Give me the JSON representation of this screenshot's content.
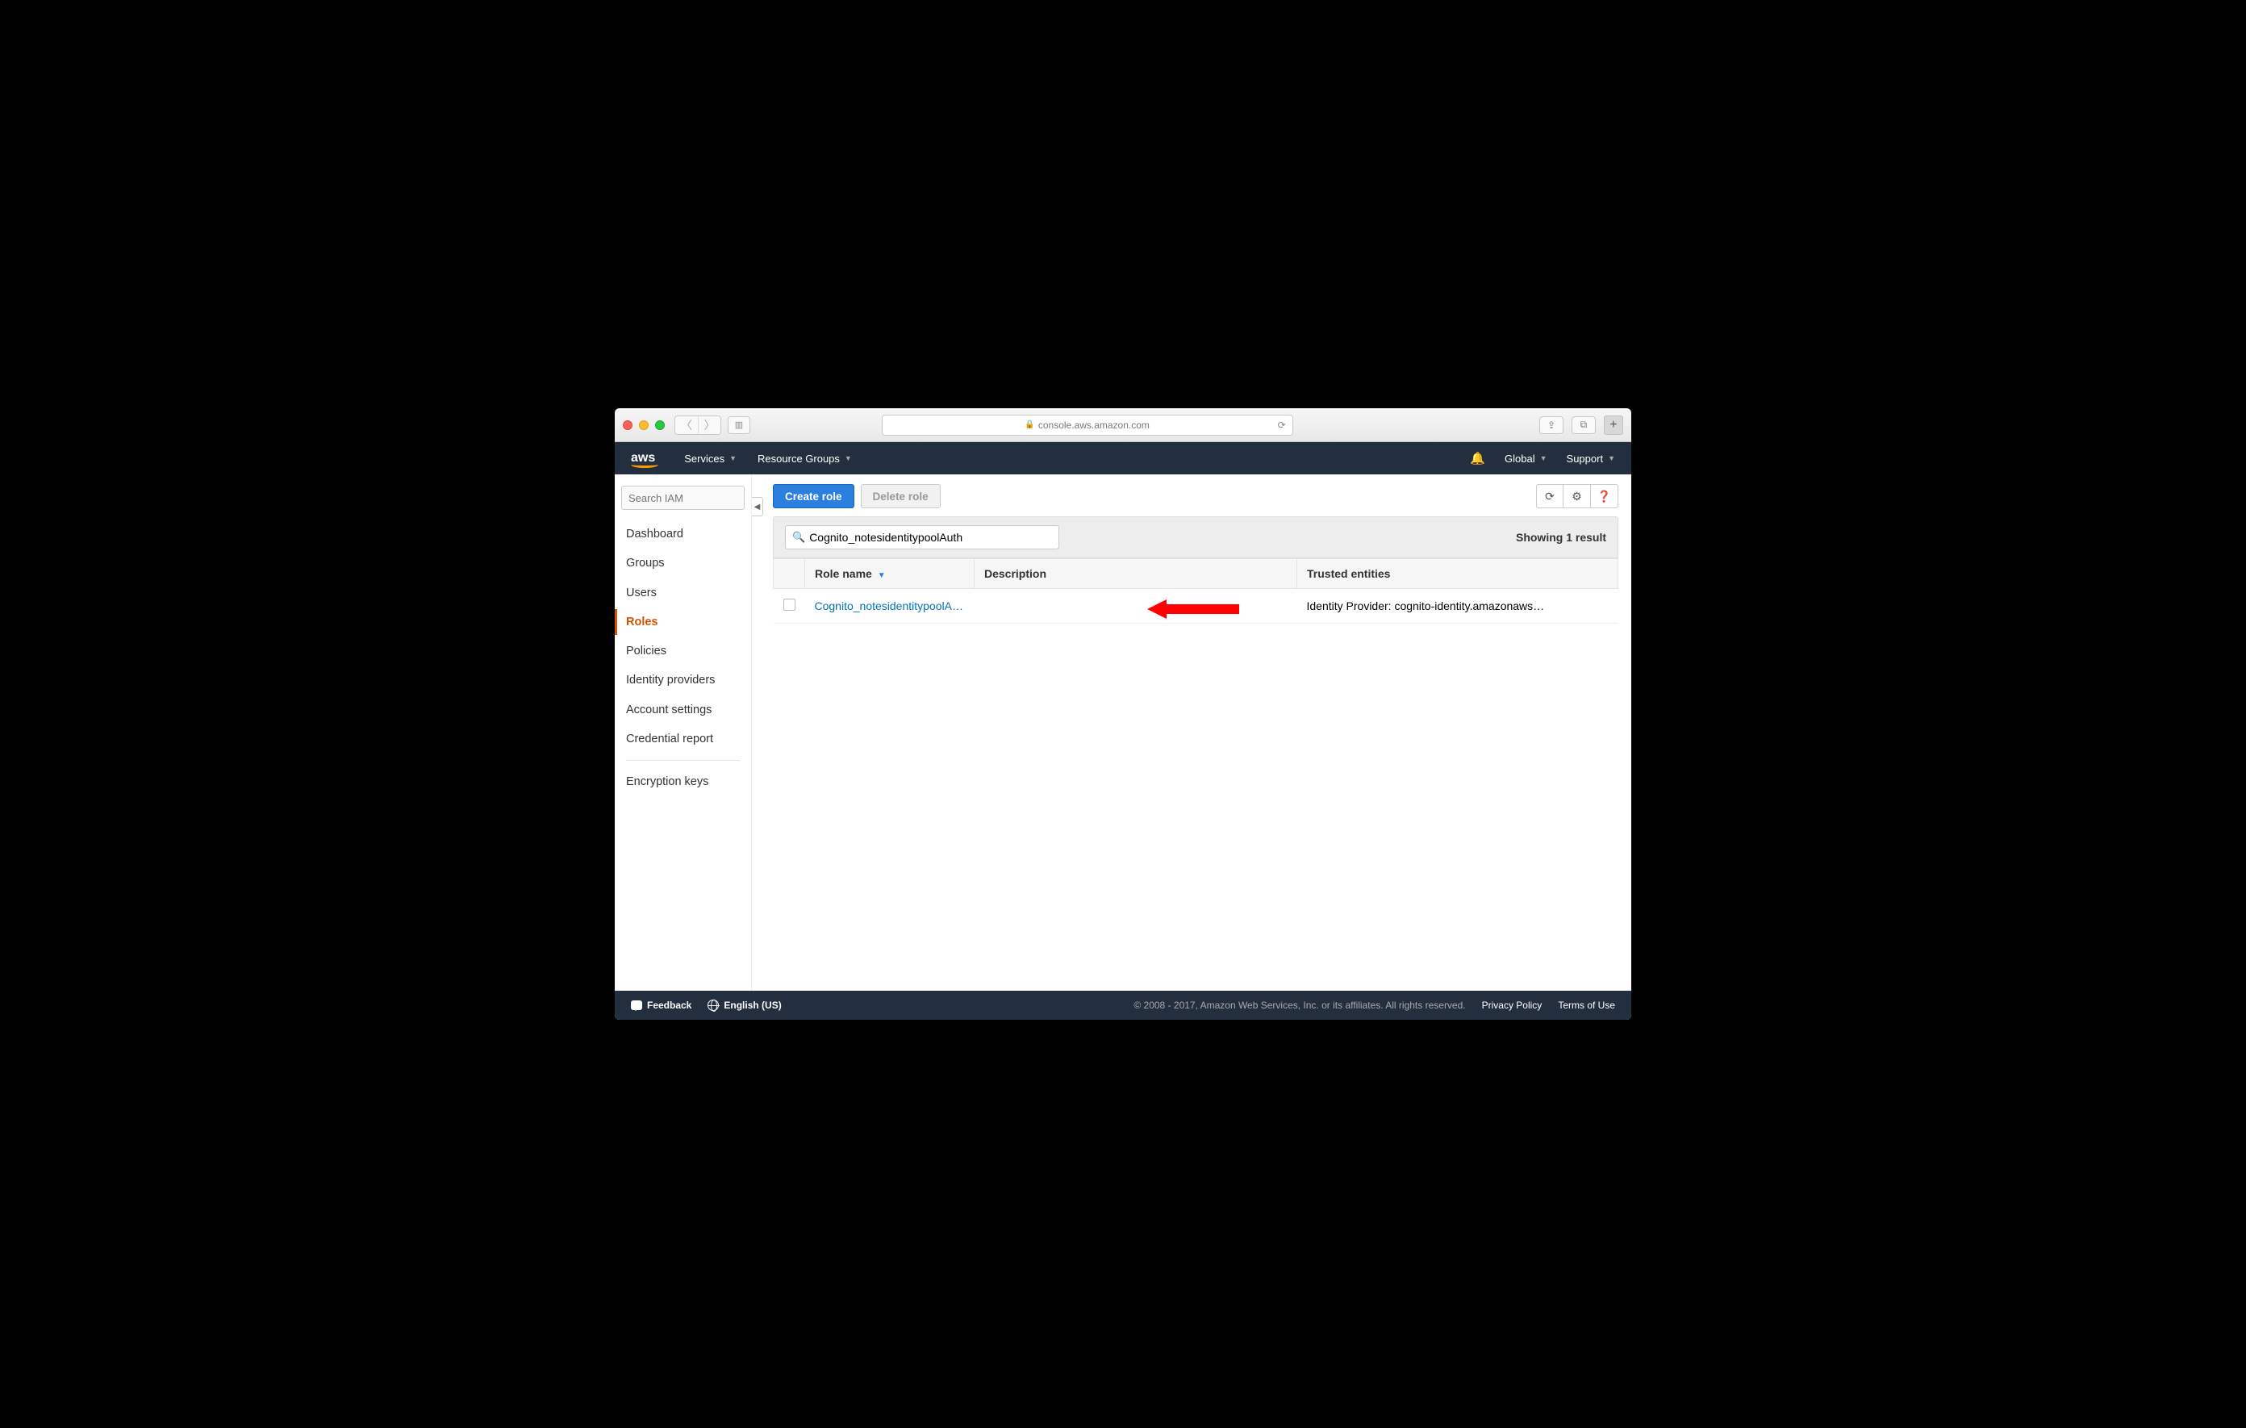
{
  "browser": {
    "url": "console.aws.amazon.com"
  },
  "header": {
    "logo": "aws",
    "services": "Services",
    "resource_groups": "Resource Groups",
    "region": "Global",
    "support": "Support"
  },
  "sidebar": {
    "search_placeholder": "Search IAM",
    "items": [
      "Dashboard",
      "Groups",
      "Users",
      "Roles",
      "Policies",
      "Identity providers",
      "Account settings",
      "Credential report"
    ],
    "active_index": 3,
    "bottom_item": "Encryption keys"
  },
  "toolbar": {
    "create_role": "Create role",
    "delete_role": "Delete role"
  },
  "filter": {
    "search_value": "Cognito_notesidentitypoolAuth",
    "result_text": "Showing 1 result"
  },
  "table": {
    "columns": {
      "role_name": "Role name",
      "description": "Description",
      "trusted": "Trusted entities"
    },
    "rows": [
      {
        "role_name": "Cognito_notesidentitypoolA…",
        "description": "",
        "trusted": "Identity Provider: cognito-identity.amazonaws…"
      }
    ]
  },
  "footer": {
    "feedback": "Feedback",
    "language": "English (US)",
    "copyright": "© 2008 - 2017, Amazon Web Services, Inc. or its affiliates. All rights reserved.",
    "privacy": "Privacy Policy",
    "terms": "Terms of Use"
  }
}
